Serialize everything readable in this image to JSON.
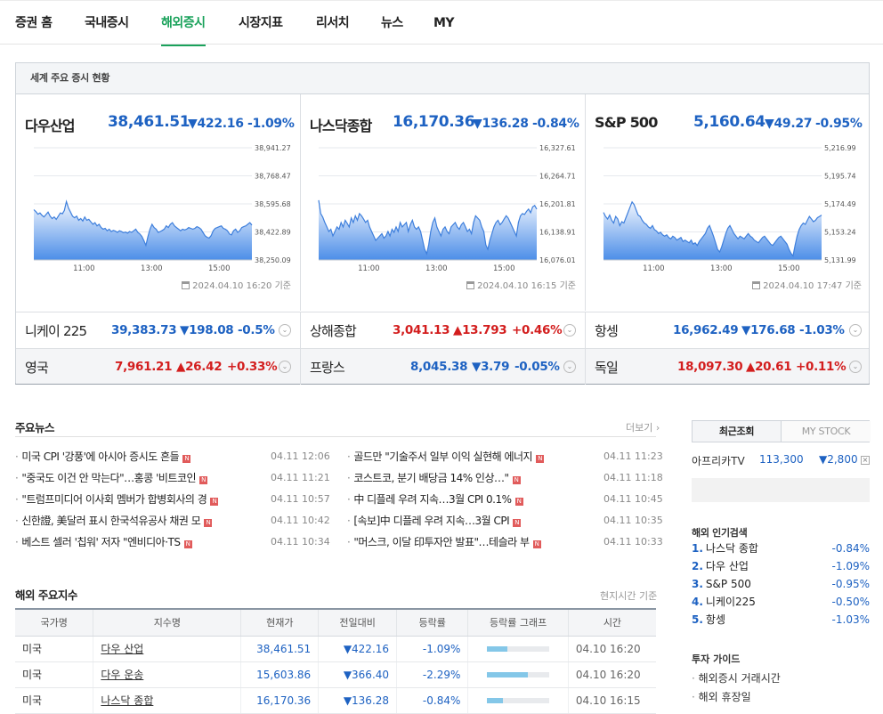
{
  "nav": [
    "증권 홈",
    "국내증시",
    "해외증시",
    "시장지표",
    "리서치",
    "뉴스",
    "MY"
  ],
  "world": {
    "title": "세계 주요 증시 현황",
    "panels": [
      {
        "name": "다우산업",
        "value": "38,461.51",
        "change": "▼422.16",
        "pct": "-1.09%",
        "yticks": [
          "38,941.27",
          "38,768.47",
          "38,595.68",
          "38,422.89",
          "38,250.09"
        ],
        "xticks": [
          "11:00",
          "13:00",
          "15:00"
        ],
        "asof": "2024.04.10 16:20 기준",
        "series": [
          38560,
          38548,
          38532,
          38540,
          38525,
          38515,
          38530,
          38545,
          38520,
          38505,
          38515,
          38500,
          38520,
          38540,
          38535,
          38555,
          38610,
          38570,
          38545,
          38520,
          38510,
          38520,
          38495,
          38505,
          38490,
          38515,
          38495,
          38500,
          38485,
          38470,
          38480,
          38460,
          38470,
          38450,
          38440,
          38445,
          38430,
          38440,
          38425,
          38432,
          38428,
          38420,
          38430,
          38425,
          38418,
          38422,
          38415,
          38425,
          38420,
          38430,
          38440,
          38420,
          38410,
          38395,
          38370,
          38340,
          38395,
          38440,
          38470,
          38450,
          38440,
          38420,
          38425,
          38432,
          38440,
          38460,
          38450,
          38470,
          38480,
          38460,
          38450,
          38440,
          38430,
          38440,
          38435,
          38440,
          38450,
          38445,
          38440,
          38445,
          38455,
          38450,
          38440,
          38420,
          38400,
          38390,
          38385,
          38400,
          38430,
          38445,
          38450,
          38455,
          38460,
          38445,
          38440,
          38430,
          38410,
          38405,
          38430,
          38440,
          38420,
          38430,
          38450,
          38455,
          38460,
          38470,
          38480,
          38465
        ]
      },
      {
        "name": "나스닥종합",
        "value": "16,170.36",
        "change": "▼136.28",
        "pct": "-0.84%",
        "yticks": [
          "16,327.61",
          "16,264.71",
          "16,201.81",
          "16,138.91",
          "16,076.01"
        ],
        "xticks": [
          "11:00",
          "13:00",
          "15:00"
        ],
        "asof": "2024.04.10 16:15 기준",
        "series": [
          16210,
          16180,
          16172,
          16160,
          16150,
          16140,
          16145,
          16130,
          16140,
          16150,
          16145,
          16160,
          16150,
          16165,
          16158,
          16150,
          16170,
          16160,
          16175,
          16165,
          16180,
          16175,
          16168,
          16160,
          16165,
          16150,
          16140,
          16130,
          16120,
          16125,
          16130,
          16135,
          16125,
          16130,
          16140,
          16130,
          16145,
          16138,
          16150,
          16140,
          16160,
          16150,
          16155,
          16160,
          16140,
          16155,
          16165,
          16150,
          16145,
          16150,
          16140,
          16120,
          16100,
          16090,
          16110,
          16140,
          16160,
          16170,
          16150,
          16140,
          16130,
          16145,
          16150,
          16140,
          16135,
          16150,
          16155,
          16160,
          16150,
          16145,
          16155,
          16160,
          16150,
          16140,
          16145,
          16135,
          16160,
          16175,
          16170,
          16165,
          16150,
          16140,
          16110,
          16100,
          16120,
          16135,
          16150,
          16160,
          16165,
          16155,
          16160,
          16168,
          16175,
          16170,
          16160,
          16150,
          16140,
          16130,
          16160,
          16175,
          16180,
          16178,
          16185,
          16190,
          16182,
          16195,
          16198,
          16190
        ]
      },
      {
        "name": "S&P 500",
        "value": "5,160.64",
        "change": "▼49.27",
        "pct": "-0.95%",
        "yticks": [
          "5,216.99",
          "5,195.74",
          "5,174.49",
          "5,153.24",
          "5,131.99"
        ],
        "xticks": [
          "11:00",
          "13:00",
          "15:00"
        ],
        "asof": "2024.04.10 17:47 기준",
        "series": [
          5168,
          5165,
          5163,
          5166,
          5162,
          5160,
          5165,
          5163,
          5158,
          5161,
          5160,
          5164,
          5168,
          5172,
          5176,
          5174,
          5170,
          5166,
          5165,
          5162,
          5160,
          5159,
          5157,
          5156,
          5158,
          5155,
          5154,
          5152,
          5153,
          5151,
          5150,
          5151,
          5149,
          5148,
          5150,
          5149,
          5147,
          5148,
          5149,
          5146,
          5147,
          5146,
          5145,
          5147,
          5144,
          5145,
          5143,
          5146,
          5148,
          5150,
          5152,
          5156,
          5158,
          5154,
          5150,
          5145,
          5140,
          5138,
          5142,
          5147,
          5152,
          5156,
          5158,
          5155,
          5152,
          5150,
          5148,
          5150,
          5149,
          5148,
          5150,
          5152,
          5150,
          5149,
          5147,
          5146,
          5145,
          5147,
          5149,
          5150,
          5148,
          5146,
          5144,
          5143,
          5145,
          5147,
          5149,
          5150,
          5148,
          5146,
          5144,
          5140,
          5137,
          5135,
          5143,
          5150,
          5155,
          5158,
          5160,
          5159,
          5162,
          5165,
          5163,
          5161,
          5162,
          5164,
          5165,
          5166
        ]
      }
    ],
    "row1": [
      {
        "name": "니케이 225",
        "value": "39,383.73",
        "change": "▼198.08",
        "pct": "-0.5%",
        "dir": "down"
      },
      {
        "name": "상해종합",
        "value": "3,041.13",
        "change": "▲13.793",
        "pct": "+0.46%",
        "dir": "up"
      },
      {
        "name": "항셍",
        "value": "16,962.49",
        "change": "▼176.68",
        "pct": "-1.03%",
        "dir": "down"
      }
    ],
    "row2": [
      {
        "name": "영국",
        "value": "7,961.21",
        "change": "▲26.42",
        "pct": "+0.33%",
        "dir": "up"
      },
      {
        "name": "프랑스",
        "value": "8,045.38",
        "change": "▼3.79",
        "pct": "-0.05%",
        "dir": "down"
      },
      {
        "name": "독일",
        "value": "18,097.30",
        "change": "▲20.61",
        "pct": "+0.11%",
        "dir": "up"
      }
    ]
  },
  "news": {
    "title": "주요뉴스",
    "more": "더보기",
    "left": [
      {
        "text": "미국 CPI '강풍'에 아시아 증시도 흔들",
        "time": "04.11 12:06"
      },
      {
        "text": "\"중국도 이건 안 막는다\"…홍콩 '비트코인",
        "time": "04.11 11:21"
      },
      {
        "text": "\"트럼프미디어 이사회 멤버가 합병회사의 경",
        "time": "04.11 10:57"
      },
      {
        "text": "신한證, 美달러 표시 한국석유공사 채권 모",
        "time": "04.11 10:42"
      },
      {
        "text": "베스트 셀러 '칩워' 저자 \"엔비디아·TS",
        "time": "04.11 10:34"
      }
    ],
    "right": [
      {
        "text": "골드만 \"기술주서 일부 이익 실현해 에너지",
        "time": "04.11 11:23"
      },
      {
        "text": "코스트코, 분기 배당금 14% 인상…\"",
        "time": "04.11 11:18"
      },
      {
        "text": "中 디플레 우려 지속…3월 CPI 0.1%",
        "time": "04.11 10:45"
      },
      {
        "text": "[속보]中 디플레 우려 지속…3월 CPI",
        "time": "04.11 10:35"
      },
      {
        "text": "\"머스크, 이달 印투자안 발표\"…테슬라 부",
        "time": "04.11 10:33"
      }
    ],
    "badge": "N"
  },
  "indices": {
    "title": "해외 주요지수",
    "note": "현지시간 기준",
    "headers": [
      "국가명",
      "지수명",
      "현재가",
      "전일대비",
      "등락률",
      "등락률 그래프",
      "시간"
    ],
    "rows": [
      {
        "country": "미국",
        "name": "다우 산업",
        "price": "38,461.51",
        "change": "▼422.16",
        "pct": "-1.09%",
        "bar": 0.32,
        "time": "04.10 16:20"
      },
      {
        "country": "미국",
        "name": "다우 운송",
        "price": "15,603.86",
        "change": "▼366.40",
        "pct": "-2.29%",
        "bar": 0.66,
        "time": "04.10 16:20"
      },
      {
        "country": "미국",
        "name": "나스닥 종합",
        "price": "16,170.36",
        "change": "▼136.28",
        "pct": "-0.84%",
        "bar": 0.25,
        "time": "04.10 16:15"
      }
    ]
  },
  "side": {
    "tab_recent": "최근조회",
    "tab_mystock": "MY STOCK",
    "recent": {
      "name": "아프리카TV",
      "price": "113,300",
      "change": "▼2,800"
    },
    "popular_title": "해외 인기검색",
    "popular": [
      {
        "rank": "1.",
        "name": "나스닥 종합",
        "pct": "-0.84%"
      },
      {
        "rank": "2.",
        "name": "다우 산업",
        "pct": "-1.09%"
      },
      {
        "rank": "3.",
        "name": "S&P 500",
        "pct": "-0.95%"
      },
      {
        "rank": "4.",
        "name": "니케이225",
        "pct": "-0.50%"
      },
      {
        "rank": "5.",
        "name": "항셍",
        "pct": "-1.03%"
      }
    ],
    "guide_title": "투자 가이드",
    "guide": [
      "해외증시 거래시간",
      "해외 휴장일"
    ]
  },
  "colors": {
    "accent": "#1aa25b",
    "down": "#1e62c2",
    "up": "#d31e1e"
  }
}
